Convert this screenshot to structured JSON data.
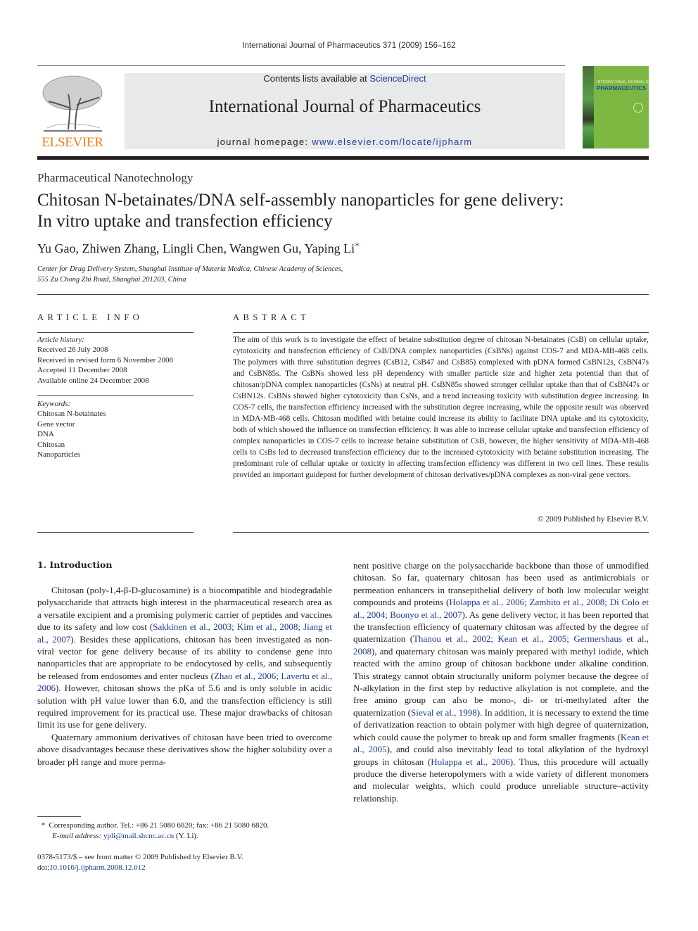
{
  "running_head": "International Journal of Pharmaceutics 371 (2009) 156–162",
  "header": {
    "publisher_logo_text": "ELSEVIER",
    "contents_prefix": "Contents lists available at ",
    "contents_link": "ScienceDirect",
    "journal_title": "International Journal of Pharmaceutics",
    "homepage_prefix": "journal homepage: ",
    "homepage_link": "www.elsevier.com/locate/ijpharm",
    "cover_line1": "INTERNATIONAL JOURNAL OF",
    "cover_line2": "PHARMACEUTICS"
  },
  "article": {
    "section": "Pharmaceutical Nanotechnology",
    "title_line1": "Chitosan N-betainates/DNA self-assembly nanoparticles for gene delivery:",
    "title_line2": "In vitro uptake and transfection efficiency",
    "authors": "Yu Gao, Zhiwen Zhang, Lingli Chen, Wangwen Gu, Yaping Li",
    "corresponding_mark": "*",
    "affiliation_line1": "Center for Drug Delivery System, Shanghai Institute of Materia Medica, Chinese Academy of Sciences,",
    "affiliation_line2": "555 Zu Chong Zhi Road, Shanghai 201203, China"
  },
  "article_info": {
    "heading": "ARTICLE INFO",
    "history_label": "Article history:",
    "history": [
      "Received 26 July 2008",
      "Received in revised form 6 November 2008",
      "Accepted 11 December 2008",
      "Available online 24 December 2008"
    ],
    "keywords_label": "Keywords:",
    "keywords": [
      "Chitosan N-betainates",
      "Gene vector",
      "DNA",
      "Chitosan",
      "Nanoparticles"
    ]
  },
  "abstract": {
    "heading": "ABSTRACT",
    "text": "The aim of this work is to investigate the effect of betaine substitution degree of chitosan N-betainates (CsB) on cellular uptake, cytotoxicity and transfection efficiency of CsB/DNA complex nanoparticles (CsBNs) against COS-7 and MDA-MB-468 cells. The polymers with three substitution degrees (CsB12, CsB47 and CsB85) complexed with pDNA formed CsBN12s, CsBN47s and CsBN85s. The CsBNs showed less pH dependency with smaller particle size and higher zeta potential than that of chitosan/pDNA complex nanoparticles (CsNs) at neutral pH. CsBN85s showed stronger cellular uptake than that of CsBN47s or CsBN12s. CsBNs showed higher cytotoxicity than CsNs, and a trend increasing toxicity with substitution degree increasing. In COS-7 cells, the transfection efficiency increased with the substitution degree increasing, while the opposite result was observed in MDA-MB-468 cells. Chitosan modified with betaine could increase its ability to facilitate DNA uptake and its cytotoxicity, both of which showed the influence on transfection efficiency. It was able to increase cellular uptake and transfection efficiency of complex nanoparticles in COS-7 cells to increase betaine substitution of CsB, however, the higher sensitivity of MDA-MB-468 cells to CsBs led to decreased transfection efficiency due to the increased cytotoxicity with betaine substitution increasing. The predominant role of cellular uptake or toxicity in affecting transfection efficiency was different in two cell lines. These results provided an important guidepost for further development of chitosan derivatives/pDNA complexes as non-viral gene vectors.",
    "copyright": "© 2009 Published by Elsevier B.V."
  },
  "introduction": {
    "heading": "1.  Introduction",
    "p1": [
      {
        "t": "Chitosan (poly-1,4-β-D-glucosamine) is a biocompatible and biodegradable polysaccharide that attracts high interest in the pharmaceutical research area as a versatile excipient and a promising polymeric carrier of peptides and vaccines due to its safety and low cost ("
      },
      {
        "c": "Sakkinen et al., 2003; Kim et al., 2008; Jiang et al., 2007"
      },
      {
        "t": "). Besides these applications, chitosan has been investigated as non-viral vector for gene delivery because of its ability to condense gene into nanoparticles that are appropriate to be endocytosed by cells, and subsequently be released from endosomes and enter nucleus ("
      },
      {
        "c": "Zhao et al., 2006; Lavertu et al., 2006"
      },
      {
        "t": "). However, chitosan shows the pKa of 5.6 and is only soluble in acidic solution with pH value lower than 6.0, and the transfection efficiency is still required improvement for its practical use. These major drawbacks of chitosan limit its use for gene delivery."
      }
    ],
    "p2": [
      {
        "t": "Quaternary ammonium derivatives of chitosan have been tried to overcome above disadvantages because these derivatives show the higher solubility over a broader pH range and more permanent positive charge on the polysaccharide backbone than those of unmodified chitosan. So far, quaternary chitosan has been used as antimicrobials or permeation enhancers in transepithelial delivery of both low molecular weight compounds and proteins ("
      },
      {
        "c": "Holappa et al., 2006; Zambito et al., 2008; Di Colo et al., 2004; Boonyo et al., 2007"
      },
      {
        "t": "). As gene delivery vector, it has been reported that the transfection efficiency of quaternary chitosan was affected by the degree of quaternization ("
      },
      {
        "c": "Thanou et al., 2002; Kean et al., 2005; Germershaus et al., 2008"
      },
      {
        "t": "), and quaternary chitosan was mainly prepared with methyl iodide, which reacted with the amino group of chitosan backbone under alkaline condition. This strategy cannot obtain structurally uniform polymer because the degree of N-alkylation in the first step by reductive alkylation is not complete, and the free amino group can also be mono-, di- or tri-methylated after the quaternization ("
      },
      {
        "c": "Sieval et al., 1998"
      },
      {
        "t": "). In addition, it is necessary to extend the time of derivatization reaction to obtain polymer with high degree of quaternization, which could cause the polymer to break up and form smaller fragments ("
      },
      {
        "c": "Kean et al., 2005"
      },
      {
        "t": "), and could also inevitably lead to total alkylation of the hydroxyl groups in chitosan ("
      },
      {
        "c": "Holappa et al., 2006"
      },
      {
        "t": "). Thus, this procedure will actually produce the diverse heteropolymers with a wide variety of different monomers and molecular weights, which could produce unreliable structure–activity relationship."
      }
    ]
  },
  "footnote": {
    "mark": "*",
    "text": "Corresponding author. Tel.: +86 21 5080 6820; fax: +86 21 5080 6820.",
    "email_label": "E-mail address: ",
    "email": "ypli@mail.shcnc.ac.cn",
    "email_suffix": " (Y. Li)."
  },
  "front_matter": {
    "issn_line": "0378-5173/$ – see front matter © 2009 Published by Elsevier B.V.",
    "doi_prefix": "doi:",
    "doi": "10.1016/j.ijpharm.2008.12.012"
  },
  "colors": {
    "link": "#1f3a8f",
    "elsevier_orange": "#f07d1a",
    "cover_green": "#7cb742"
  }
}
